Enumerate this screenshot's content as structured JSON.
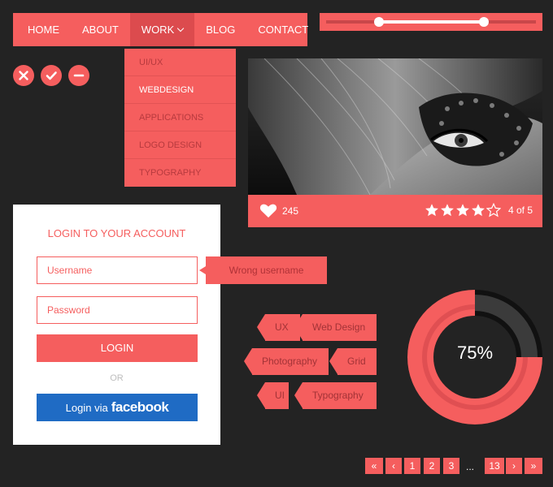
{
  "nav": {
    "items": [
      {
        "label": "HOME"
      },
      {
        "label": "ABOUT"
      },
      {
        "label": "WORK"
      },
      {
        "label": "BLOG"
      },
      {
        "label": "CONTACT"
      }
    ],
    "active_item": "WORK"
  },
  "dropdown": {
    "items": [
      {
        "label": "UI/UX"
      },
      {
        "label": "WEBDESIGN"
      },
      {
        "label": "APPLICATIONS"
      },
      {
        "label": "LOGO DESIGN"
      },
      {
        "label": "TYPOGRAPHY"
      }
    ],
    "active_item": "WEBDESIGN"
  },
  "slider": {
    "low": 0.25,
    "high": 0.75
  },
  "icon_buttons": [
    "close-icon",
    "check-icon",
    "minus-icon"
  ],
  "photo_card": {
    "likes": "245",
    "rating": 4,
    "rating_max": 5,
    "rating_text": "4 of 5"
  },
  "login": {
    "title": "LOGIN TO YOUR ACCOUNT",
    "username_placeholder": "Username",
    "password_placeholder": "Password",
    "login_label": "LOGIN",
    "or_label": "OR",
    "facebook_via": "Login via",
    "facebook_brand": "facebook",
    "error": "Wrong username"
  },
  "tags": {
    "row1": [
      "UX",
      "Web Design"
    ],
    "row2": [
      "Photography",
      "Grid"
    ],
    "row3": [
      "UI",
      "Typography"
    ]
  },
  "donut": {
    "percent": 75,
    "label": "75%"
  },
  "pagination": {
    "first": "«",
    "prev": "‹",
    "pages": [
      "1",
      "2",
      "3"
    ],
    "ellipsis": "...",
    "last_page": "13",
    "next": "›",
    "last": "»"
  },
  "colors": {
    "accent": "#f55e5e",
    "accent_dark": "#dc4b4e",
    "background": "#232323",
    "facebook": "#1f6bc4"
  }
}
